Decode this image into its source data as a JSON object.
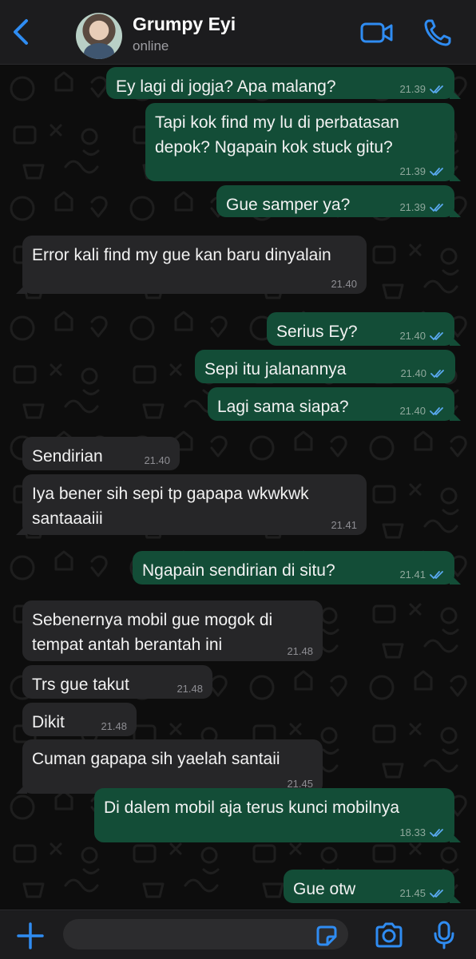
{
  "header": {
    "contact_name": "Grumpy Eyi",
    "contact_status": "online"
  },
  "colors": {
    "accent": "#2f8cf2",
    "outgoing_bubble": "#134d37",
    "incoming_bubble": "#262628",
    "read_ticks": "#5aa9f0"
  },
  "messages": [
    {
      "dir": "out",
      "text": "Ey lagi di jogja? Apa malang?",
      "time": "21.39",
      "read": true
    },
    {
      "dir": "out",
      "text": "Tapi kok find my lu di perbatasan depok? Ngapain kok stuck gitu?",
      "time": "21.39",
      "read": true
    },
    {
      "dir": "out",
      "text": "Gue samper ya?",
      "time": "21.39",
      "read": true
    },
    {
      "dir": "in",
      "text": "Error kali find my gue kan baru dinyalain",
      "time": "21.40"
    },
    {
      "dir": "out",
      "text": "Serius Ey?",
      "time": "21.40",
      "read": true
    },
    {
      "dir": "out",
      "text": "Sepi itu jalanannya",
      "time": "21.40",
      "read": true
    },
    {
      "dir": "out",
      "text": "Lagi sama siapa?",
      "time": "21.40",
      "read": true
    },
    {
      "dir": "in",
      "text": "Sendirian",
      "time": "21.40"
    },
    {
      "dir": "in",
      "text": "Iya bener sih sepi tp gapapa wkwkwk santaaaiii",
      "time": "21.41"
    },
    {
      "dir": "out",
      "text": "Ngapain sendirian di situ?",
      "time": "21.41",
      "read": true
    },
    {
      "dir": "in",
      "text": "Sebenernya mobil gue mogok di tempat antah berantah ini",
      "time": "21.48"
    },
    {
      "dir": "in",
      "text": "Trs gue takut",
      "time": "21.48"
    },
    {
      "dir": "in",
      "text": "Dikit",
      "time": "21.48"
    },
    {
      "dir": "in",
      "text": "Cuman gapapa sih yaelah santaii",
      "time": "21.45"
    },
    {
      "dir": "out",
      "text": "Di dalem mobil aja terus kunci mobilnya",
      "time": "18.33",
      "read": true
    },
    {
      "dir": "out",
      "text": "Gue otw",
      "time": "21.45",
      "read": true
    }
  ],
  "icons": {
    "back": "chevron-left-icon",
    "video": "video-camera-icon",
    "call": "phone-icon",
    "attach": "plus-icon",
    "sticker": "sticker-icon",
    "camera": "camera-icon",
    "mic": "microphone-icon"
  },
  "composer": {
    "value": "",
    "placeholder": ""
  }
}
